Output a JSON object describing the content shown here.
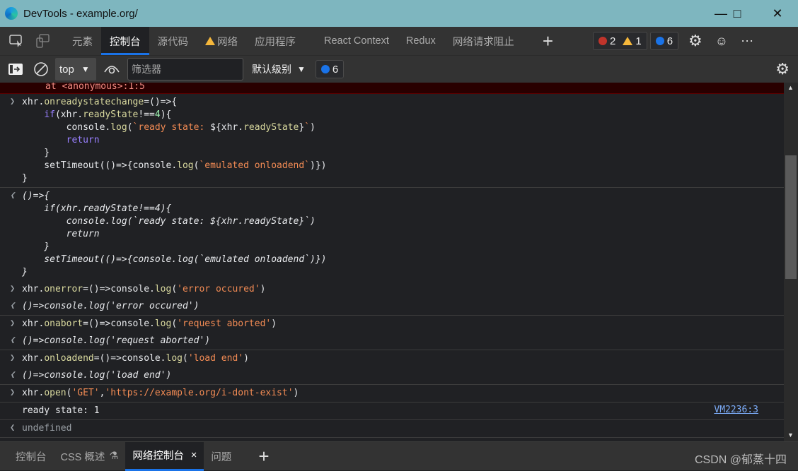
{
  "window": {
    "title": "DevTools - example.org/"
  },
  "tabs": [
    {
      "label": "元素"
    },
    {
      "label": "控制台",
      "active": true
    },
    {
      "label": "源代码"
    },
    {
      "label": "网络",
      "warning": true
    },
    {
      "label": "应用程序"
    },
    {
      "label": "React Context"
    },
    {
      "label": "Redux"
    },
    {
      "label": "网络请求阻止"
    }
  ],
  "badges": {
    "errors": "2",
    "warnings": "1",
    "messages": "6"
  },
  "toolbar": {
    "context": "top",
    "filter_placeholder": "筛选器",
    "level": "默认级别",
    "messages": "6"
  },
  "console": {
    "error_tail": "at <anonymous>:1:5",
    "entries": [
      {
        "dir": "in",
        "lines": [
          [
            [
              "xhr.",
              ""
            ],
            [
              "onreadystatechange",
              "p"
            ],
            [
              "=()=>{",
              ""
            ]
          ],
          [
            [
              "    ",
              ""
            ],
            [
              "if",
              "k"
            ],
            [
              "(xhr.",
              ""
            ],
            [
              "readyState",
              "p"
            ],
            [
              "!==",
              ""
            ],
            [
              "4",
              "n"
            ],
            [
              "){",
              ""
            ]
          ],
          [
            [
              "        console.",
              ""
            ],
            [
              "log",
              "p"
            ],
            [
              "(",
              ""
            ],
            [
              "`ready state: ",
              "s"
            ],
            [
              "${xhr.",
              ""
            ],
            [
              "readyState",
              "p"
            ],
            [
              "}",
              ""
            ],
            [
              "`",
              "s"
            ],
            [
              ")",
              ""
            ]
          ],
          [
            [
              "        ",
              ""
            ],
            [
              "return",
              "k"
            ]
          ],
          [
            [
              "    }",
              ""
            ]
          ],
          [
            [
              "    setTimeout(()=>{console.",
              ""
            ],
            [
              "log",
              "p"
            ],
            [
              "(",
              ""
            ],
            [
              "`emulated onloadend`",
              "s"
            ],
            [
              ")})",
              ""
            ]
          ],
          [
            [
              "}",
              ""
            ]
          ]
        ]
      },
      {
        "dir": "out",
        "italic": true,
        "lines": [
          [
            [
              "()=>{",
              ""
            ]
          ],
          [
            [
              "    if(xhr.readyState!==4){",
              ""
            ]
          ],
          [
            [
              "        console.log(`ready state: ${xhr.readyState}`)",
              ""
            ]
          ],
          [
            [
              "        return",
              ""
            ]
          ],
          [
            [
              "    }",
              ""
            ]
          ],
          [
            [
              "    setTimeout(()=>{console.log(`emulated onloadend`)})",
              ""
            ]
          ],
          [
            [
              "}",
              ""
            ]
          ]
        ],
        "nosep": true
      },
      {
        "dir": "in",
        "lines": [
          [
            [
              "xhr.",
              ""
            ],
            [
              "onerror",
              "p"
            ],
            [
              "=()=>console.",
              ""
            ],
            [
              "log",
              "p"
            ],
            [
              "(",
              ""
            ],
            [
              "'error occured'",
              "s"
            ],
            [
              ")",
              ""
            ]
          ]
        ],
        "nosep": true
      },
      {
        "dir": "out",
        "italic": true,
        "lines": [
          [
            [
              "()=>console.log('error occured')",
              ""
            ]
          ]
        ]
      },
      {
        "dir": "in",
        "lines": [
          [
            [
              "xhr.",
              ""
            ],
            [
              "onabort",
              "p"
            ],
            [
              "=()=>console.",
              ""
            ],
            [
              "log",
              "p"
            ],
            [
              "(",
              ""
            ],
            [
              "'request aborted'",
              "s"
            ],
            [
              ")",
              ""
            ]
          ]
        ],
        "nosep": true
      },
      {
        "dir": "out",
        "italic": true,
        "lines": [
          [
            [
              "()=>console.log('request aborted')",
              ""
            ]
          ]
        ]
      },
      {
        "dir": "in",
        "lines": [
          [
            [
              "xhr.",
              ""
            ],
            [
              "onloadend",
              "p"
            ],
            [
              "=()=>console.",
              ""
            ],
            [
              "log",
              "p"
            ],
            [
              "(",
              ""
            ],
            [
              "'load end'",
              "s"
            ],
            [
              ")",
              ""
            ]
          ]
        ],
        "nosep": true
      },
      {
        "dir": "out",
        "italic": true,
        "lines": [
          [
            [
              "()=>console.log('load end')",
              ""
            ]
          ]
        ]
      },
      {
        "dir": "in",
        "lines": [
          [
            [
              "xhr.",
              ""
            ],
            [
              "open",
              "p"
            ],
            [
              "(",
              ""
            ],
            [
              "'GET'",
              "s"
            ],
            [
              ",",
              ""
            ],
            [
              "'https://example.org/i-dont-exist'",
              "s"
            ],
            [
              ")",
              ""
            ]
          ]
        ]
      },
      {
        "dir": "log",
        "lines": [
          [
            [
              "ready state: 1",
              ""
            ]
          ]
        ],
        "source": "VM2236:3"
      },
      {
        "dir": "out",
        "lines": [
          [
            [
              "undefined",
              "u"
            ]
          ]
        ]
      }
    ]
  },
  "drawer": {
    "tabs": [
      {
        "label": "控制台"
      },
      {
        "label": "CSS 概述"
      },
      {
        "label": "网络控制台",
        "active": true
      },
      {
        "label": "问题"
      }
    ]
  },
  "watermark": "CSDN @郁蒸十四"
}
